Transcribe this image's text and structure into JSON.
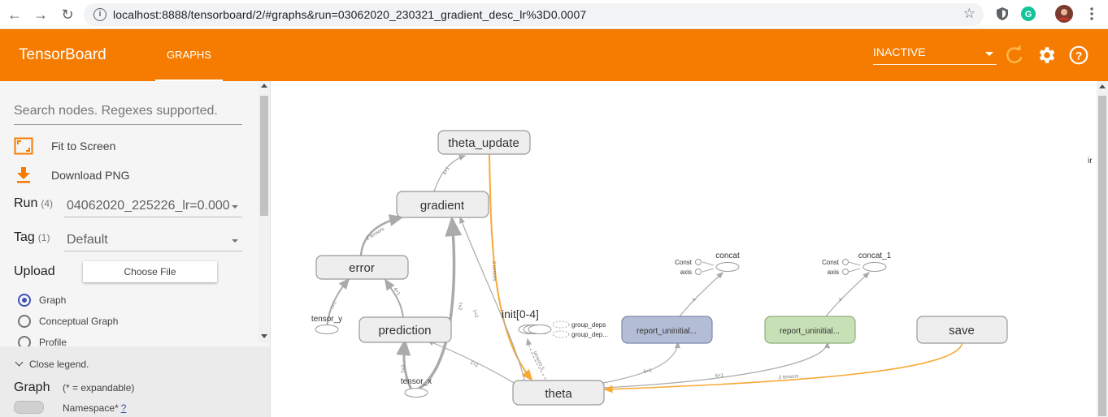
{
  "browser": {
    "url": "localhost:8888/tensorboard/2/#graphs&run=03062020_230321_gradient_desc_lr%3D0.0007"
  },
  "header": {
    "app_title": "TensorBoard",
    "tab": "GRAPHS",
    "status": "INACTIVE",
    "accent_color": "#f57c00"
  },
  "sidebar": {
    "search_placeholder": "Search nodes. Regexes supported.",
    "fit_to_screen": "Fit to Screen",
    "download_png": "Download PNG",
    "run_label": "Run",
    "run_count": "(4)",
    "run_value": "04062020_225226_lr=0.000",
    "tag_label": "Tag",
    "tag_count": "(1)",
    "tag_value": "Default",
    "upload_label": "Upload",
    "choose_file": "Choose File",
    "radio_options": [
      "Graph",
      "Conceptual Graph",
      "Profile"
    ],
    "radio_selected": "Graph",
    "legend_toggle": "Close legend.",
    "legend_title": "Graph",
    "legend_subtitle": "(* = expandable)",
    "namespace_label": "Namespace*",
    "namespace_help": "?"
  },
  "graph": {
    "nodes": {
      "theta_update": "theta_update",
      "gradient": "gradient",
      "error": "error",
      "prediction": "prediction",
      "theta": "theta",
      "save": "save",
      "report1": "report_uninitial...",
      "report2": "report_uninitial...",
      "tensor_y": "tensor_y",
      "tensor_x": "tensor_x",
      "init": "init[0-4]",
      "group_deps_1": "group_deps",
      "group_deps_2": "group_dep...",
      "concat": "concat",
      "concat_1": "concat_1",
      "const_a": "Const",
      "axis_a": "axis",
      "const_b": "Const",
      "axis_b": "axis"
    },
    "edge_labels": {
      "e_gradient_update": "4×1",
      "e_error_gradient": "2 tensors",
      "e_update_theta": "2 tensors",
      "e_pred_error": "4×1",
      "e_y_error": "?×1",
      "e_x_pred": "?×2",
      "e_x_gradient": "?×2",
      "e_theta_pred": "1×2",
      "e_init_theta": "tensors 5",
      "e_theta_report1": "6×1",
      "e_theta_report2": "6×1",
      "e_save_theta": "2 tensors",
      "e_theta_gradient": "1×2",
      "e_report1_concat": "4",
      "e_report2_concat": "4"
    },
    "edge_text": "ir"
  }
}
